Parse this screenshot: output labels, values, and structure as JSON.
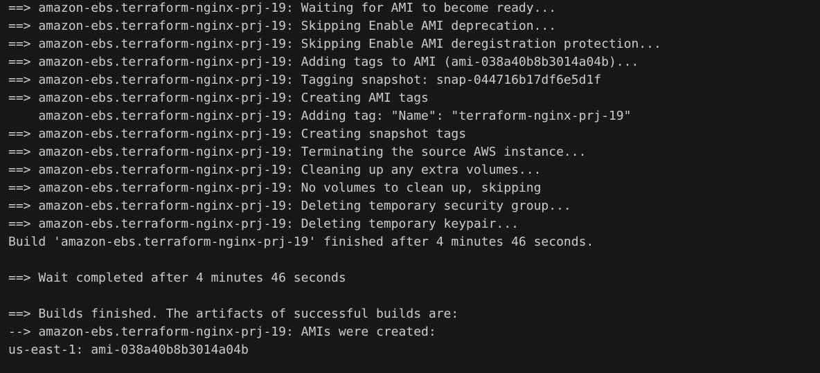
{
  "terminal": {
    "lines": [
      "==> amazon-ebs.terraform-nginx-prj-19: Waiting for AMI to become ready...",
      "==> amazon-ebs.terraform-nginx-prj-19: Skipping Enable AMI deprecation...",
      "==> amazon-ebs.terraform-nginx-prj-19: Skipping Enable AMI deregistration protection...",
      "==> amazon-ebs.terraform-nginx-prj-19: Adding tags to AMI (ami-038a40b8b3014a04b)...",
      "==> amazon-ebs.terraform-nginx-prj-19: Tagging snapshot: snap-044716b17df6e5d1f",
      "==> amazon-ebs.terraform-nginx-prj-19: Creating AMI tags",
      "    amazon-ebs.terraform-nginx-prj-19: Adding tag: \"Name\": \"terraform-nginx-prj-19\"",
      "==> amazon-ebs.terraform-nginx-prj-19: Creating snapshot tags",
      "==> amazon-ebs.terraform-nginx-prj-19: Terminating the source AWS instance...",
      "==> amazon-ebs.terraform-nginx-prj-19: Cleaning up any extra volumes...",
      "==> amazon-ebs.terraform-nginx-prj-19: No volumes to clean up, skipping",
      "==> amazon-ebs.terraform-nginx-prj-19: Deleting temporary security group...",
      "==> amazon-ebs.terraform-nginx-prj-19: Deleting temporary keypair...",
      "Build 'amazon-ebs.terraform-nginx-prj-19' finished after 4 minutes 46 seconds.",
      "",
      "==> Wait completed after 4 minutes 46 seconds",
      "",
      "==> Builds finished. The artifacts of successful builds are:",
      "--> amazon-ebs.terraform-nginx-prj-19: AMIs were created:",
      "us-east-1: ami-038a40b8b3014a04b"
    ]
  },
  "colors": {
    "background": "#181818",
    "text": "#cccccc"
  }
}
